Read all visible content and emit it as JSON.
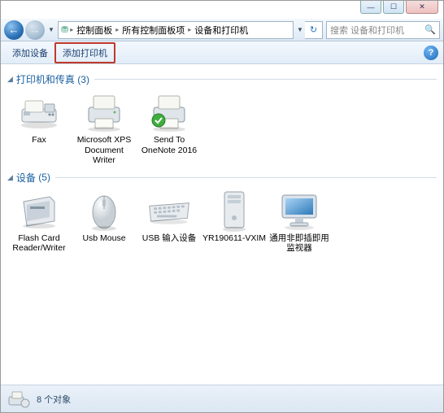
{
  "caption": {
    "min": "—",
    "max": "☐",
    "close": "✕"
  },
  "nav": {
    "back_icon": "←",
    "fwd_icon": "→",
    "dropdown": "▼"
  },
  "path": {
    "root_icon": "⛃",
    "seg1": "控制面板",
    "seg2": "所有控制面板项",
    "seg3": "设备和打印机",
    "arrow": "▸"
  },
  "search": {
    "placeholder": "搜索 设备和打印机",
    "icon": "🔍"
  },
  "refresh_icon": "↻",
  "toolbar": {
    "add_device": "添加设备",
    "add_printer": "添加打印机",
    "help": "?"
  },
  "groups": {
    "printers": {
      "title": "打印机和传真",
      "count": "(3)"
    },
    "devices": {
      "title": "设备",
      "count": "(5)"
    }
  },
  "printers": [
    {
      "label": "Fax"
    },
    {
      "label": "Microsoft XPS Document Writer"
    },
    {
      "label": "Send To OneNote 2016"
    }
  ],
  "devices": [
    {
      "label": "Flash Card Reader/Writer"
    },
    {
      "label": "Usb Mouse"
    },
    {
      "label": "USB 输入设备"
    },
    {
      "label": "YR190611-VXIM"
    },
    {
      "label": "通用非即插即用监视器"
    }
  ],
  "status": {
    "count_text": "8 个对象"
  }
}
